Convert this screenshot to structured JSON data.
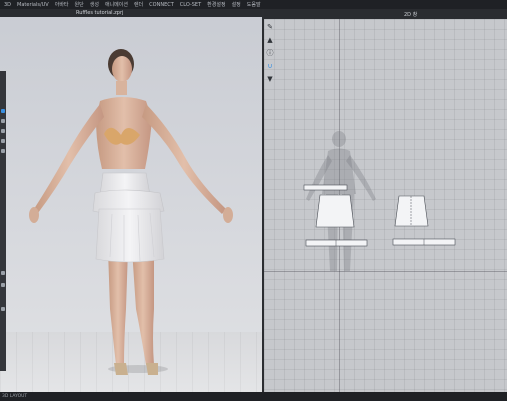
{
  "menubar": {
    "items": [
      "3D",
      "Materials/UV",
      "아바타",
      "원단",
      "생성",
      "애니메이션",
      "렌더",
      "CONNECT",
      "CLO-SET",
      "환경설정",
      "설정",
      "도움말"
    ]
  },
  "left_panel": {
    "file_tab": "Ruffles tutorial.zprj"
  },
  "right_panel": {
    "zoom_label": "2D 창",
    "tools": [
      "pen-icon",
      "shirt-icon",
      "info-icon",
      "stitch-icon",
      "tshirt-icon"
    ]
  },
  "status_bar": {
    "text": "3D LAYOUT"
  },
  "colors": {
    "accent": "#3a8fe0",
    "menubar_bg": "#1f2125",
    "viewport_bg": "#d6d8dd",
    "pattern_fill": "#f3f4f6"
  }
}
